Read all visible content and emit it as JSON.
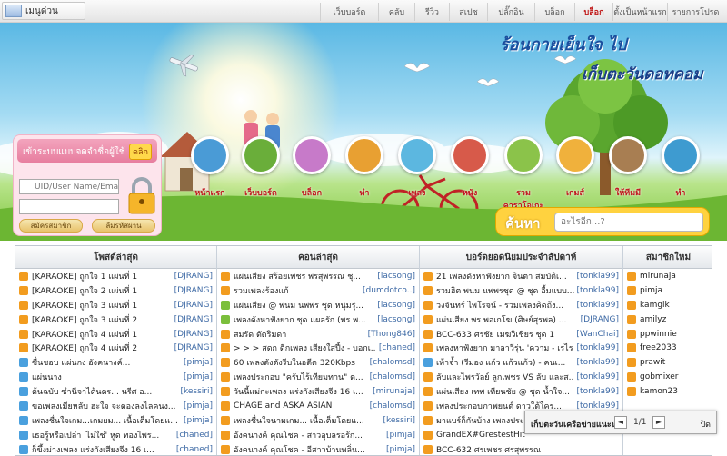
{
  "topbar": {
    "menu_label": "เมนูด่วน",
    "nav": [
      "เว็บบอร์ด",
      "คลับ",
      "รีวิว",
      "สเปซ",
      "ปลั๊กอิน",
      "บล็อก",
      "บล็อก",
      "ตั้งเป็นหน้าแรก",
      "รายการโปรด"
    ],
    "active_index": 6
  },
  "banner": {
    "title_line1": "ร้อนกายเย็นใจ ไป",
    "title_line2": "เก็บตะวันดอทคอม"
  },
  "login": {
    "header": "เข้าระบบแบบจดจำชื่อผู้ใช้",
    "click_label": "คลิก",
    "uid_placeholder": "UID/User Name/Email",
    "password_placeholder": "",
    "register_label": "สมัครสมาชิก",
    "forgot_label": "ลืมรหัสผ่าน"
  },
  "categories": [
    {
      "label": "หน้าแรก",
      "color": "#4a9bd6"
    },
    {
      "label": "เว็บบอร์ด",
      "color": "#6aae3a"
    },
    {
      "label": "บล็อก",
      "color": "#c77ac9"
    },
    {
      "label": "ทำ",
      "color": "#e8a032"
    },
    {
      "label": "เพลง",
      "color": "#5cb7e0"
    },
    {
      "label": "หนัง",
      "color": "#d75a4a"
    },
    {
      "label": "รวมคาราโอเกะ",
      "color": "#8bc34a"
    },
    {
      "label": "เกมส์",
      "color": "#f0b13c"
    },
    {
      "label": "ให้ทีมมี",
      "color": "#a87e52"
    },
    {
      "label": "ทำ",
      "color": "#3e9bd0"
    }
  ],
  "search": {
    "label": "ค้นหา",
    "placeholder": "อะไรอีก...?"
  },
  "columns": [
    {
      "header": "โพสต์ล่าสุด",
      "rows": [
        {
          "text": "[KARAOKE] ถูกใจ 1 แผ่นที่ 1",
          "user": "[DJRANG]",
          "icon": "#f29c1f"
        },
        {
          "text": "[KARAOKE] ถูกใจ 2 แผ่นที่ 1",
          "user": "[DJRANG]",
          "icon": "#f29c1f"
        },
        {
          "text": "[KARAOKE] ถูกใจ 3 แผ่นที่ 1",
          "user": "[DJRANG]",
          "icon": "#f29c1f"
        },
        {
          "text": "[KARAOKE] ถูกใจ 3 แผ่นที่ 2",
          "user": "[DJRANG]",
          "icon": "#f29c1f"
        },
        {
          "text": "[KARAOKE] ถูกใจ 4 แผ่นที่ 1",
          "user": "[DJRANG]",
          "icon": "#f29c1f"
        },
        {
          "text": "[KARAOKE] ถูกใจ 4 แผ่นที่ 2",
          "user": "[DJRANG]",
          "icon": "#f29c1f"
        },
        {
          "text": "ซื่นชอบ แผ่นกง อังคนางค์...",
          "user": "[pimja]",
          "icon": "#4aa0de"
        },
        {
          "text": "แผ่นนาง",
          "user": "[pimja]",
          "icon": "#4aa0de"
        },
        {
          "text": "ต้นฉบับ ซำนีจาได้นตร... นรีศ อ...",
          "user": "[kessiri]",
          "icon": "#4aa0de"
        },
        {
          "text": "ขอเพลงเมียหลับ ฮะใจ จะตองลงไลคนง...",
          "user": "[pimja]",
          "icon": "#4aa0de"
        },
        {
          "text": "เพลงชื่นใจเกม...เกมยม... เนื้อเต็มโดยแ...",
          "user": "[pimja]",
          "icon": "#4aa0de"
        },
        {
          "text": "เธอรู้หรือเปล่า 'ไม่ใช่' หูด ทองไพร...",
          "user": "[chaned]",
          "icon": "#4aa0de"
        },
        {
          "text": "ก็ขึ้งม่างเพลง แร่งกังเสียงจีง 16 เ...",
          "user": "[chaned]",
          "icon": "#4aa0de"
        }
      ]
    },
    {
      "header": "คอนล่าสุด",
      "rows": [
        {
          "text": "แผ่นเสียง สร้อยเพชร พรสุพรรณ ชุ...",
          "user": "[lacsong]",
          "icon": "#f29c1f"
        },
        {
          "text": "รวมเพลงร้องแก้",
          "user": "[dumdotco..]",
          "icon": "#f29c1f"
        },
        {
          "text": "แผ่นเสียง @ พนม นพพร ชุด หนุ่มรุ่...",
          "user": "[lacsong]",
          "icon": "#7bbf3c"
        },
        {
          "text": "เพลงดังหาฟังยาก ชุด แผลรัก (พร พ...",
          "user": "[lacsong]",
          "icon": "#7bbf3c"
        },
        {
          "text": "สมรัด ตัดริมดา",
          "user": "[Thong846]",
          "icon": "#f29c1f"
        },
        {
          "text": "> > > สดก ดีกเพลง เสียงใสปี้ง - บอกเ...",
          "user": "[chaned]",
          "icon": "#f29c1f"
        },
        {
          "text": "60 เพลงดังตังรีบในอดีต 320Kbps",
          "user": "[chalomsd]",
          "icon": "#f29c1f"
        },
        {
          "text": "เพลงประกอบ \"ครับไร้เทียมทาน\" ต...",
          "user": "[chalomsd]",
          "icon": "#f29c1f"
        },
        {
          "text": "วันนี้แม่กะเพลง แร่งกังเสียงจีง 16 เ...",
          "user": "[mirunaja]",
          "icon": "#f29c1f"
        },
        {
          "text": "CHAGE and ASKA ASIAN",
          "user": "[chalomsd]",
          "icon": "#f29c1f"
        },
        {
          "text": "เพลงชื่นใจนามเกม... เนื้อเต็มโดยแ...",
          "user": "[kessiri]",
          "icon": "#f29c1f"
        },
        {
          "text": "อังคนางค์ คุณโชค - สาวอุบลรอรัก...",
          "user": "[pimja]",
          "icon": "#f29c1f"
        },
        {
          "text": "อังคนางค์ คุณโชค - อีสาวบ้านพลิ่น...",
          "user": "[pimja]",
          "icon": "#f29c1f"
        }
      ]
    },
    {
      "header": "บอร์ดยอดนิยมประจำสัปดาห์",
      "rows": [
        {
          "text": "21 เพลงดังหาฟังยาก จินตา สมบัติเ...",
          "user": "[tonkla99]",
          "icon": "#f29c1f"
        },
        {
          "text": "รวมฮิต พนม นพพรชุด @ ชุด อื้มแบบ...",
          "user": "[tonkla99]",
          "icon": "#f29c1f"
        },
        {
          "text": "วงจันทร์ ไพโรจน์ - รวมเพลงคิดถึง...",
          "user": "[tonkla99]",
          "icon": "#f29c1f"
        },
        {
          "text": "แผ่นเสียง พร พอเกโฆ (ศิษย์สุรพล) ...",
          "user": "[DJRANG]",
          "icon": "#f29c1f"
        },
        {
          "text": "BCC-633 ศรชัย เมฆวิเชียร ชุด 1",
          "user": "[WanChai]",
          "icon": "#f29c1f"
        },
        {
          "text": "เพลงหาฟังยาก มาลาวีรุ่น 'ความ - เรไร คน...",
          "user": "[tonkla99]",
          "icon": "#f29c1f"
        },
        {
          "text": "เท้าจ้ำ (รีมอง แก้ว แก้วแก้ว) - คนเ...",
          "user": "[tonkla99]",
          "icon": "#4aa0de"
        },
        {
          "text": "ลับและไพรวัลย์ ลูกเพชร VS ลับ และส...",
          "user": "[tonkla99]",
          "icon": "#f29c1f"
        },
        {
          "text": "แผ่นเสียง เทพ เทียนชัย @ ชุด น้ำใจ...",
          "user": "[tonkla99]",
          "icon": "#f29c1f"
        },
        {
          "text": "เพลงประกอบภาพยนต์ ดาวใต้ใคร...",
          "user": "[tonkla99]",
          "icon": "#f29c1f"
        },
        {
          "text": "มาแบร์ก็กันบ้าง เพลงประกอ...",
          "user": "",
          "icon": "#f29c1f"
        },
        {
          "text": "GrandEX#GrestestHit",
          "user": "",
          "icon": "#f29c1f"
        },
        {
          "text": "BCC-632 ศรเพชร ศรสุพรรณ",
          "user": "",
          "icon": "#f29c1f"
        }
      ]
    },
    {
      "header": "สมาชิกใหม่",
      "rows": [
        {
          "text": "mirunaja",
          "user": "",
          "icon": "#f29c1f"
        },
        {
          "text": "pimja",
          "user": "",
          "icon": "#f29c1f"
        },
        {
          "text": "kamgik",
          "user": "",
          "icon": "#f29c1f"
        },
        {
          "text": "amilyz",
          "user": "",
          "icon": "#f29c1f"
        },
        {
          "text": "ppwinnie",
          "user": "",
          "icon": "#f29c1f"
        },
        {
          "text": "free2033",
          "user": "",
          "icon": "#f29c1f"
        },
        {
          "text": "prawit",
          "user": "",
          "icon": "#f29c1f"
        },
        {
          "text": "gobmixer",
          "user": "",
          "icon": "#f29c1f"
        },
        {
          "text": "kamon23",
          "user": "",
          "icon": "#f29c1f"
        },
        {
          "text": "",
          "user": "",
          "icon": ""
        },
        {
          "text": "",
          "user": "",
          "icon": ""
        },
        {
          "text": "",
          "user": "",
          "icon": ""
        },
        {
          "text": "",
          "user": "",
          "icon": ""
        }
      ]
    }
  ],
  "pager": {
    "title": "เก็บตะวันเครือข่ายแนะนำ",
    "prev": "◄",
    "current": "1",
    "of": "/1",
    "next": "►",
    "close": "ปิด"
  }
}
